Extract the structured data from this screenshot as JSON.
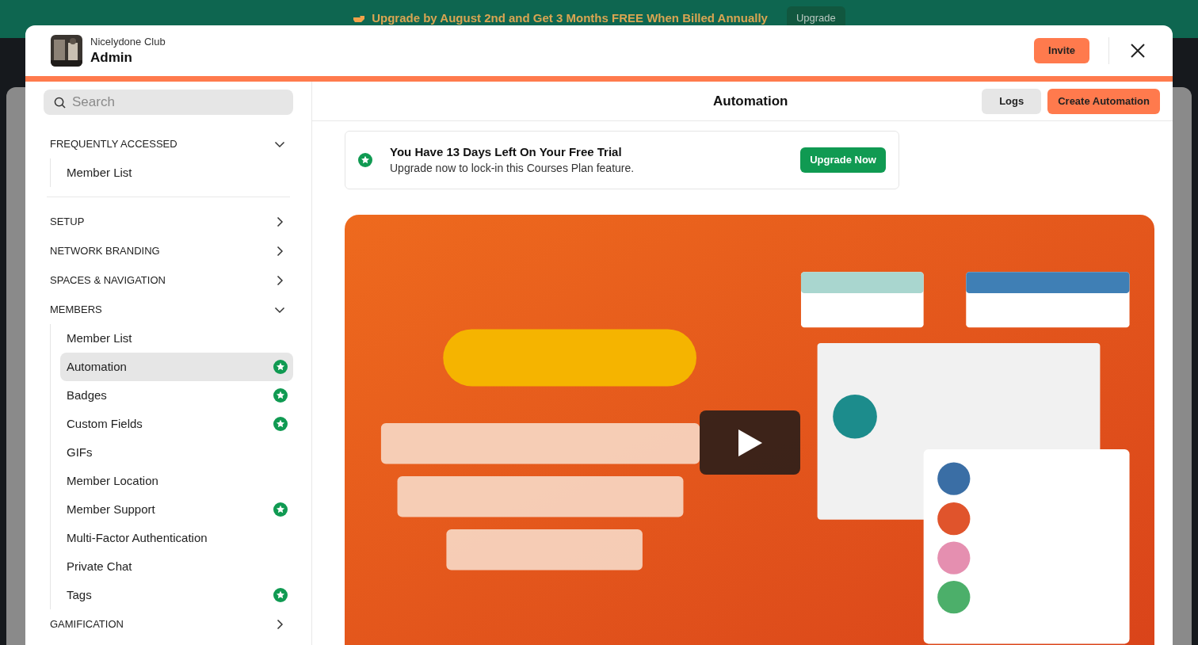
{
  "banner": {
    "text": "Upgrade by August 2nd and Get 3 Months FREE When Billed Annually",
    "button": "Upgrade"
  },
  "modal": {
    "subtitle": "Nicelydone Club",
    "title": "Admin",
    "invite": "Invite"
  },
  "search": {
    "placeholder": "Search"
  },
  "sidebar": {
    "sections": [
      {
        "label": "FREQUENTLY ACCESSED",
        "expanded": true,
        "items": [
          {
            "label": "Member List",
            "selected": false,
            "premium": false
          }
        ]
      },
      {
        "label": "SETUP",
        "expanded": false
      },
      {
        "label": "NETWORK BRANDING",
        "expanded": false
      },
      {
        "label": "SPACES & NAVIGATION",
        "expanded": false
      },
      {
        "label": "MEMBERS",
        "expanded": true,
        "items": [
          {
            "label": "Member List",
            "selected": false,
            "premium": false
          },
          {
            "label": "Automation",
            "selected": true,
            "premium": true
          },
          {
            "label": "Badges",
            "selected": false,
            "premium": true
          },
          {
            "label": "Custom Fields",
            "selected": false,
            "premium": true
          },
          {
            "label": "GIFs",
            "selected": false,
            "premium": false
          },
          {
            "label": "Member Location",
            "selected": false,
            "premium": false
          },
          {
            "label": "Member Support",
            "selected": false,
            "premium": true
          },
          {
            "label": "Multi-Factor Authentication",
            "selected": false,
            "premium": false
          },
          {
            "label": "Private Chat",
            "selected": false,
            "premium": false
          },
          {
            "label": "Tags",
            "selected": false,
            "premium": true
          }
        ]
      },
      {
        "label": "GAMIFICATION",
        "expanded": false
      }
    ]
  },
  "content": {
    "title": "Automation",
    "logs": "Logs",
    "create": "Create Automation",
    "trial": {
      "title": "You Have 13 Days Left On Your Free Trial",
      "text": "Upgrade now to lock-in this Courses Plan feature.",
      "button": "Upgrade Now"
    }
  }
}
